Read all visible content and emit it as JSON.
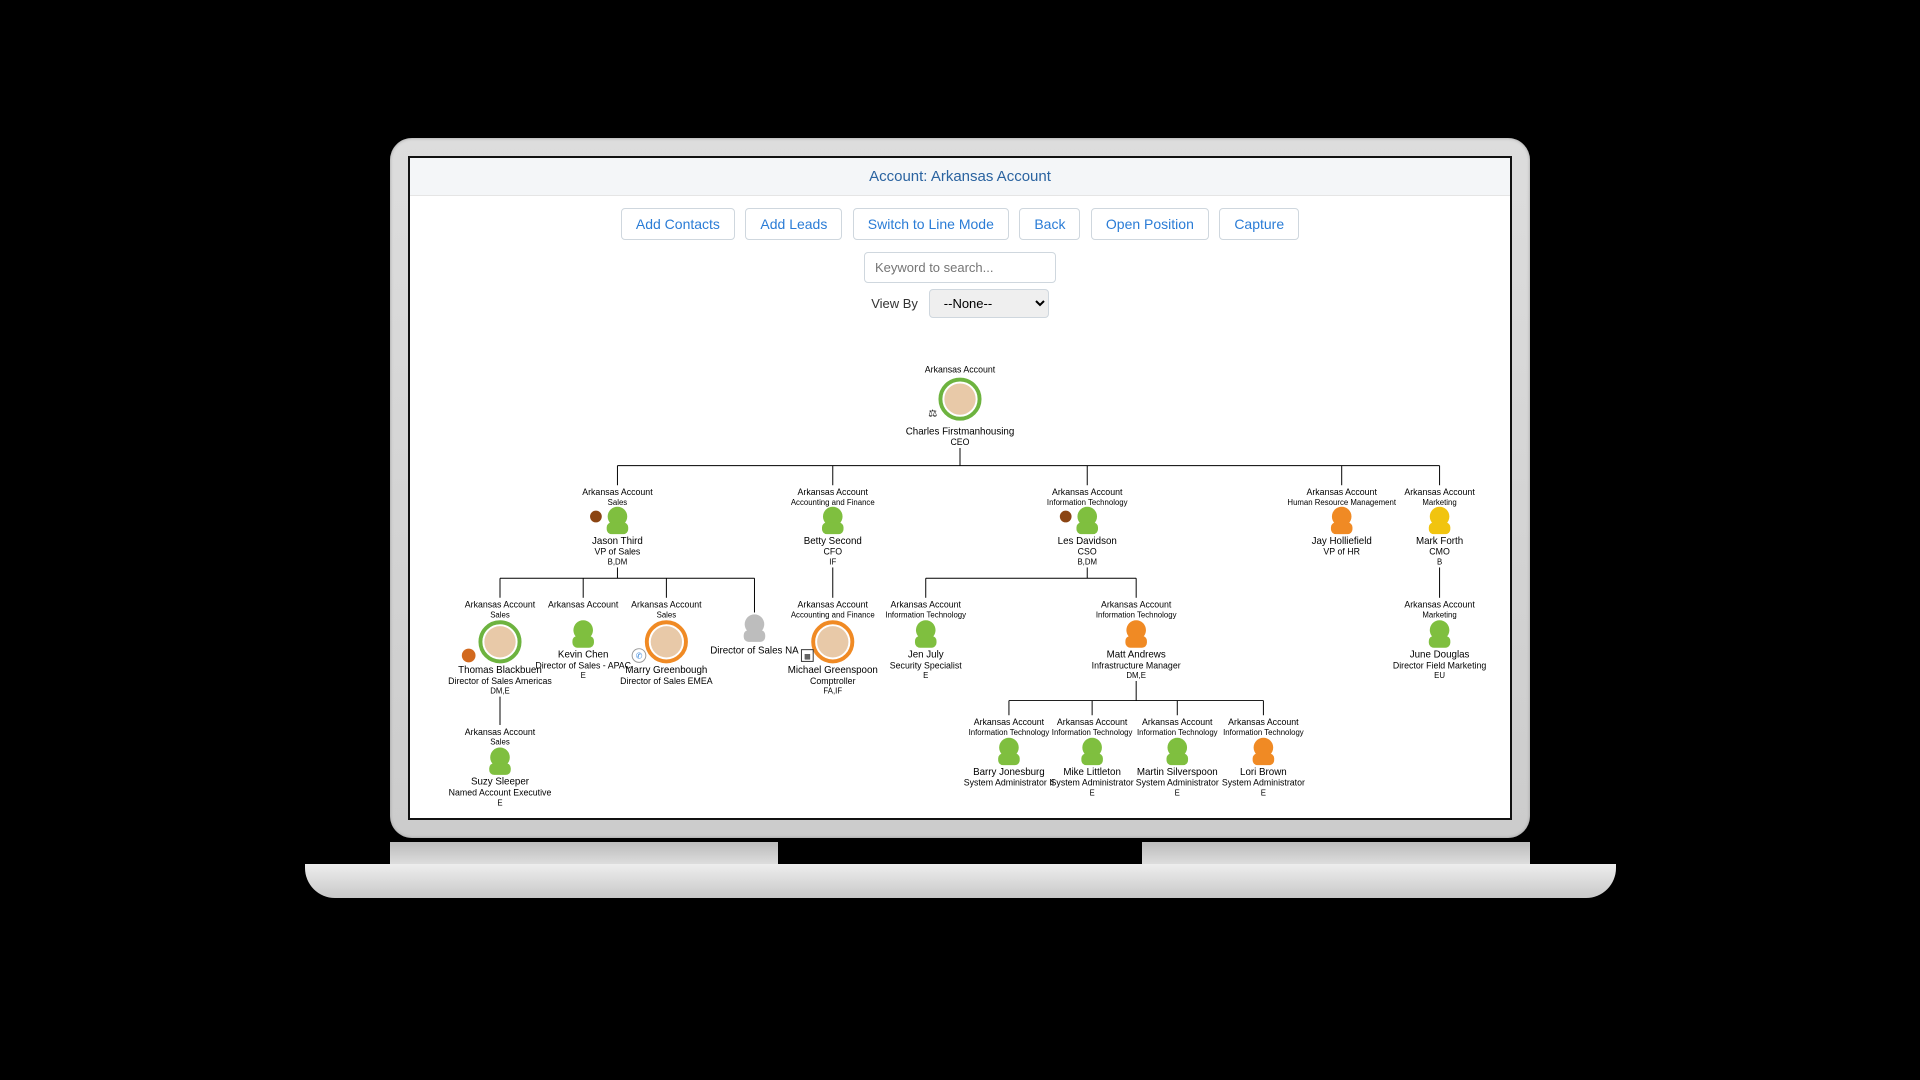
{
  "header": {
    "title": "Account: Arkansas Account"
  },
  "toolbar": {
    "buttons": [
      "Add Contacts",
      "Add Leads",
      "Switch to Line Mode",
      "Back",
      "Open Position",
      "Capture"
    ],
    "search_placeholder": "Keyword to search...",
    "view_by_label": "View By",
    "view_by_value": "--None--"
  },
  "org": {
    "account": "Arkansas Account",
    "root": {
      "name": "Charles Firstmanhousing",
      "title": "CEO",
      "dept": "",
      "avatar": "photo-green"
    },
    "level2": [
      {
        "name": "Jason Third",
        "title": "VP of Sales",
        "dept": "Sales",
        "code": "B,DM",
        "avatar": "icon-green",
        "badge": true
      },
      {
        "name": "Betty Second",
        "title": "CFO",
        "dept": "Accounting and Finance",
        "code": "IF",
        "avatar": "icon-green"
      },
      {
        "name": "Les Davidson",
        "title": "CSO",
        "dept": "Information Technology",
        "code": "B,DM",
        "avatar": "icon-green",
        "badge": true
      },
      {
        "name": "Jay Holliefield",
        "title": "VP of HR",
        "dept": "Human Resource Management",
        "code": "",
        "avatar": "icon-orange"
      },
      {
        "name": "Mark Forth",
        "title": "CMO",
        "dept": "Marketing",
        "code": "B",
        "avatar": "icon-yellow"
      }
    ],
    "jason_children": [
      {
        "name": "Thomas Blackbuen",
        "title": "Director of Sales Americas",
        "dept": "Sales",
        "code": "DM,E",
        "avatar": "photo-green",
        "badge": true
      },
      {
        "name": "Kevin Chen",
        "title": "Director of Sales - APAC",
        "dept": "",
        "code": "E",
        "avatar": "icon-green"
      },
      {
        "name": "Marry Greenbough",
        "title": "Director of Sales EMEA",
        "dept": "Sales",
        "code": "",
        "avatar": "photo-orange",
        "phone": true
      },
      {
        "name": "",
        "title": "Director of Sales NA",
        "dept": "",
        "code": "",
        "avatar": "icon-grey"
      }
    ],
    "thomas_child": {
      "name": "Suzy Sleeper",
      "title": "Named Account Executive",
      "dept": "Sales",
      "code": "E",
      "avatar": "icon-green"
    },
    "betty_child": {
      "name": "Michael Greenspoon",
      "title": "Comptroller",
      "dept": "Accounting and Finance",
      "code": "FA,IF",
      "avatar": "photo-orange",
      "qr": true
    },
    "les_children": [
      {
        "name": "Jen July",
        "title": "Security Specialist",
        "dept": "Information Technology",
        "code": "E",
        "avatar": "icon-green"
      },
      {
        "name": "Matt Andrews",
        "title": "Infrastructure Manager",
        "dept": "Information Technology",
        "code": "DM,E",
        "avatar": "icon-orange"
      }
    ],
    "matt_children": [
      {
        "name": "Barry Jonesburg",
        "title": "System Administrator II",
        "dept": "Information Technology",
        "code": "",
        "avatar": "icon-green"
      },
      {
        "name": "Mike Littleton",
        "title": "System Administrator",
        "dept": "Information Technology",
        "code": "E",
        "avatar": "icon-green"
      },
      {
        "name": "Martin Silverspoon",
        "title": "System Administrator",
        "dept": "Information Technology",
        "code": "E",
        "avatar": "icon-green"
      },
      {
        "name": "Lori Brown",
        "title": "System Administrator",
        "dept": "Information Technology",
        "code": "E",
        "avatar": "icon-orange"
      }
    ],
    "mark_child": {
      "name": "June Douglas",
      "title": "Director Field Marketing",
      "dept": "Marketing",
      "code": "EU",
      "avatar": "icon-green"
    }
  }
}
